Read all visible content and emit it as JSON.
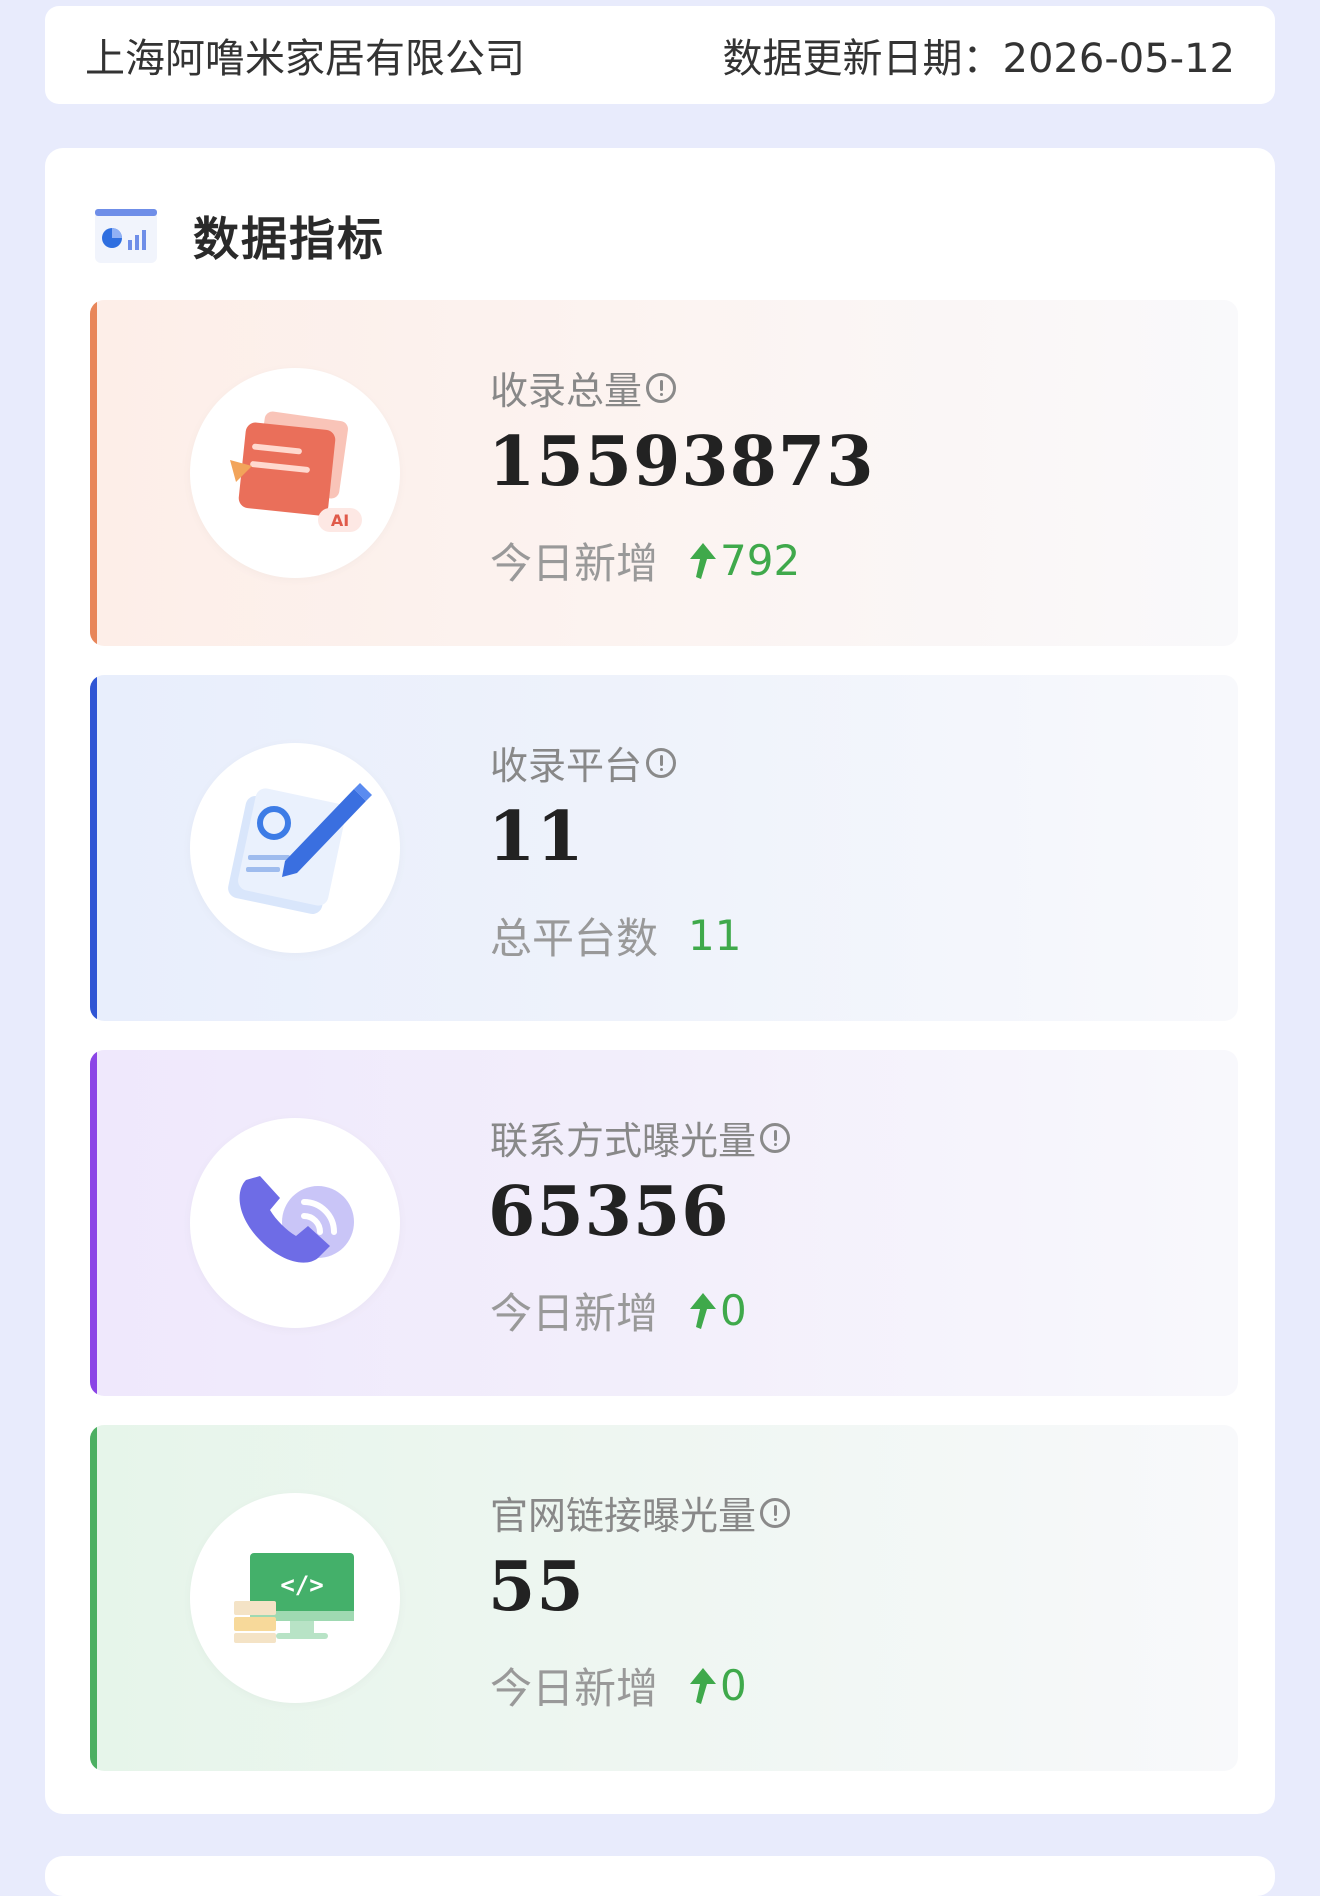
{
  "header": {
    "company_name": "上海阿噜米家居有限公司",
    "update_date": "数据更新日期：2026-05-12"
  },
  "section": {
    "title": "数据指标",
    "icon": "chart-icon"
  },
  "metrics": [
    {
      "label": "收录总量",
      "value": "15593873",
      "sub_label": "今日新增",
      "sub_value": "792",
      "sub_trend": "up",
      "accent_color": "#e8865a",
      "icon": "document-ai-icon"
    },
    {
      "label": "收录平台",
      "value": "11",
      "sub_label": "总平台数",
      "sub_value": "11",
      "sub_trend": "none",
      "accent_color": "#2f55d4",
      "icon": "pen-document-icon"
    },
    {
      "label": "联系方式曝光量",
      "value": "65356",
      "sub_label": "今日新增",
      "sub_value": "0",
      "sub_trend": "up",
      "accent_color": "#8b45e6",
      "icon": "phone-icon"
    },
    {
      "label": "官网链接曝光量",
      "value": "55",
      "sub_label": "今日新增",
      "sub_value": "0",
      "sub_trend": "up",
      "accent_color": "#4caf62",
      "icon": "monitor-code-icon"
    }
  ],
  "colors": {
    "page_background": "#e8ebfc",
    "trend_green": "#3fa94b"
  }
}
